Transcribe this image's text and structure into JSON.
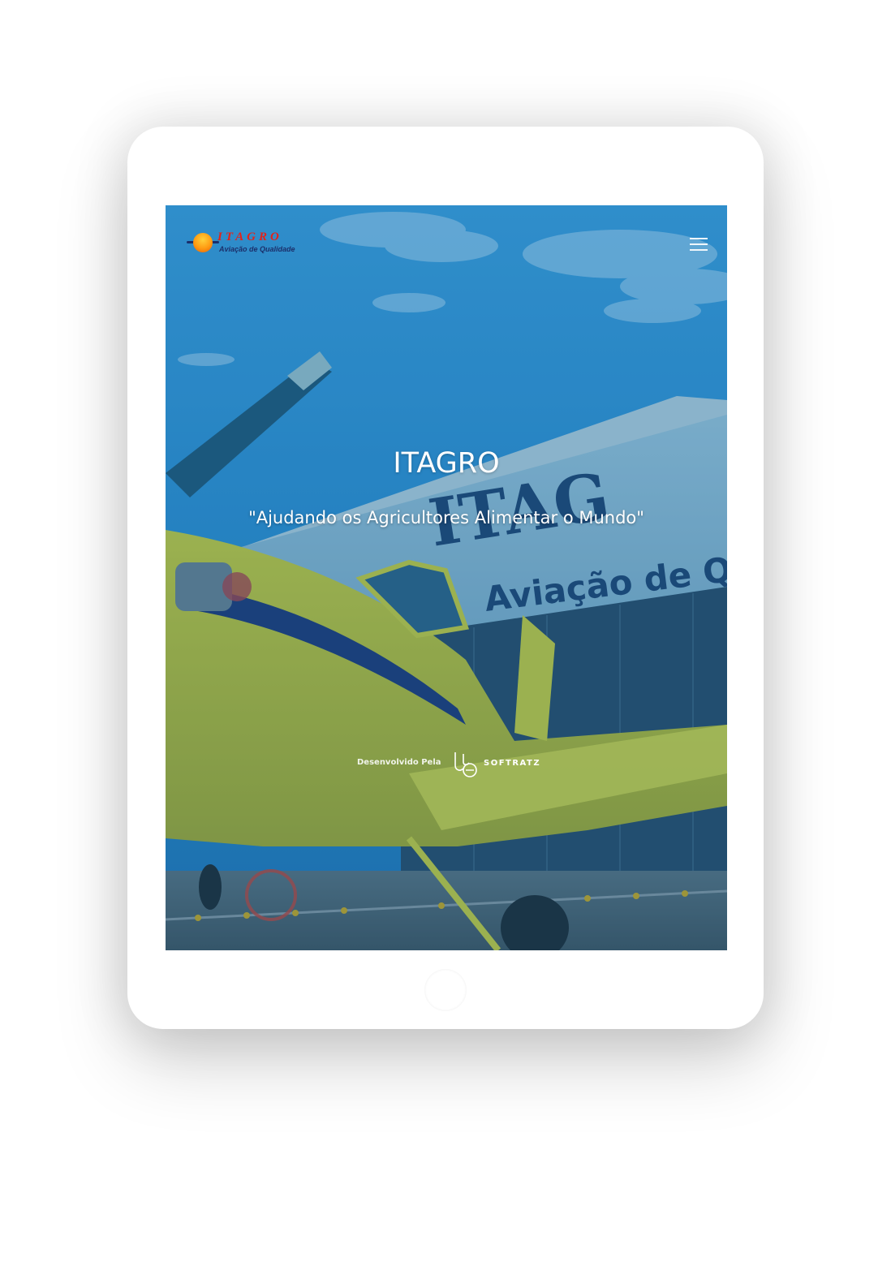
{
  "header": {
    "logo": {
      "name": "ITAGRO",
      "tagline": "Aviação de Qualidade"
    },
    "menu_icon": "hamburger-menu-icon"
  },
  "hero": {
    "title": "ITAGRO",
    "subtitle": "\"Ajudando os Agricultores Alimentar o Mundo\"",
    "background_text": [
      "ITAG",
      "Aviação de Q"
    ]
  },
  "footer_credit": {
    "label": "Desenvolvido Pela",
    "brand": "SOFTRATZ",
    "icon": "softratz-logo-icon"
  },
  "colors": {
    "sky": "#2f8fd0",
    "plane_yellow": "#c9c52a",
    "logo_red": "#e2231a",
    "logo_navy": "#1b2f6b"
  }
}
